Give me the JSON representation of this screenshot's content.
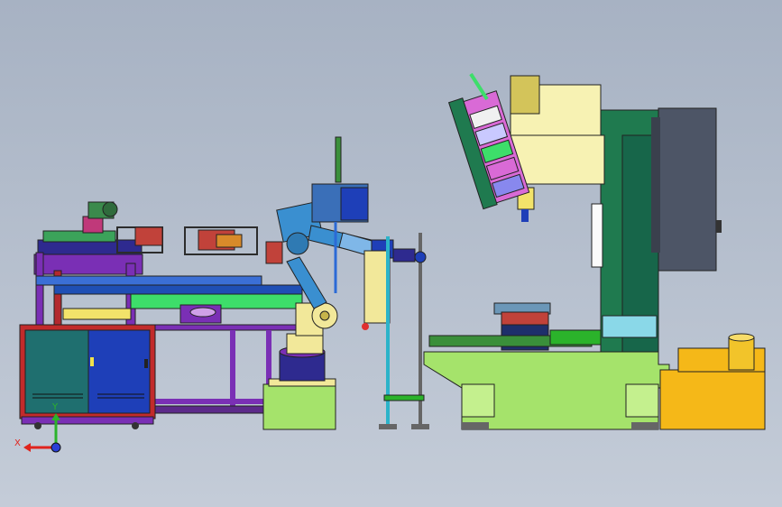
{
  "viewport": {
    "background_top": "#a7b2c3",
    "background_bottom": "#c4ccd8"
  },
  "triad": {
    "x_label": "X",
    "y_label": "Y",
    "x_color": "#e0241d",
    "y_color": "#2bb32b",
    "z_color": "#2a3fd6"
  },
  "colors": {
    "cabinet_frame": "#c22b2b",
    "cabinet_door": "#1f6f6f",
    "cabinet_door_right": "#1e3fb8",
    "frame_purple": "#7a2fb5",
    "conveyor_green": "#3dde6a",
    "robot_blue": "#3a8fd0",
    "robot_yellow": "#f2e89a",
    "machine_green": "#1f7a4f",
    "machine_base": "#a5e36b",
    "machine_head": "#f7f2b3",
    "tool_magazine_pink": "#d96ad6",
    "coolant_tank": "#f5b818",
    "motor_dark": "#4d5566"
  }
}
